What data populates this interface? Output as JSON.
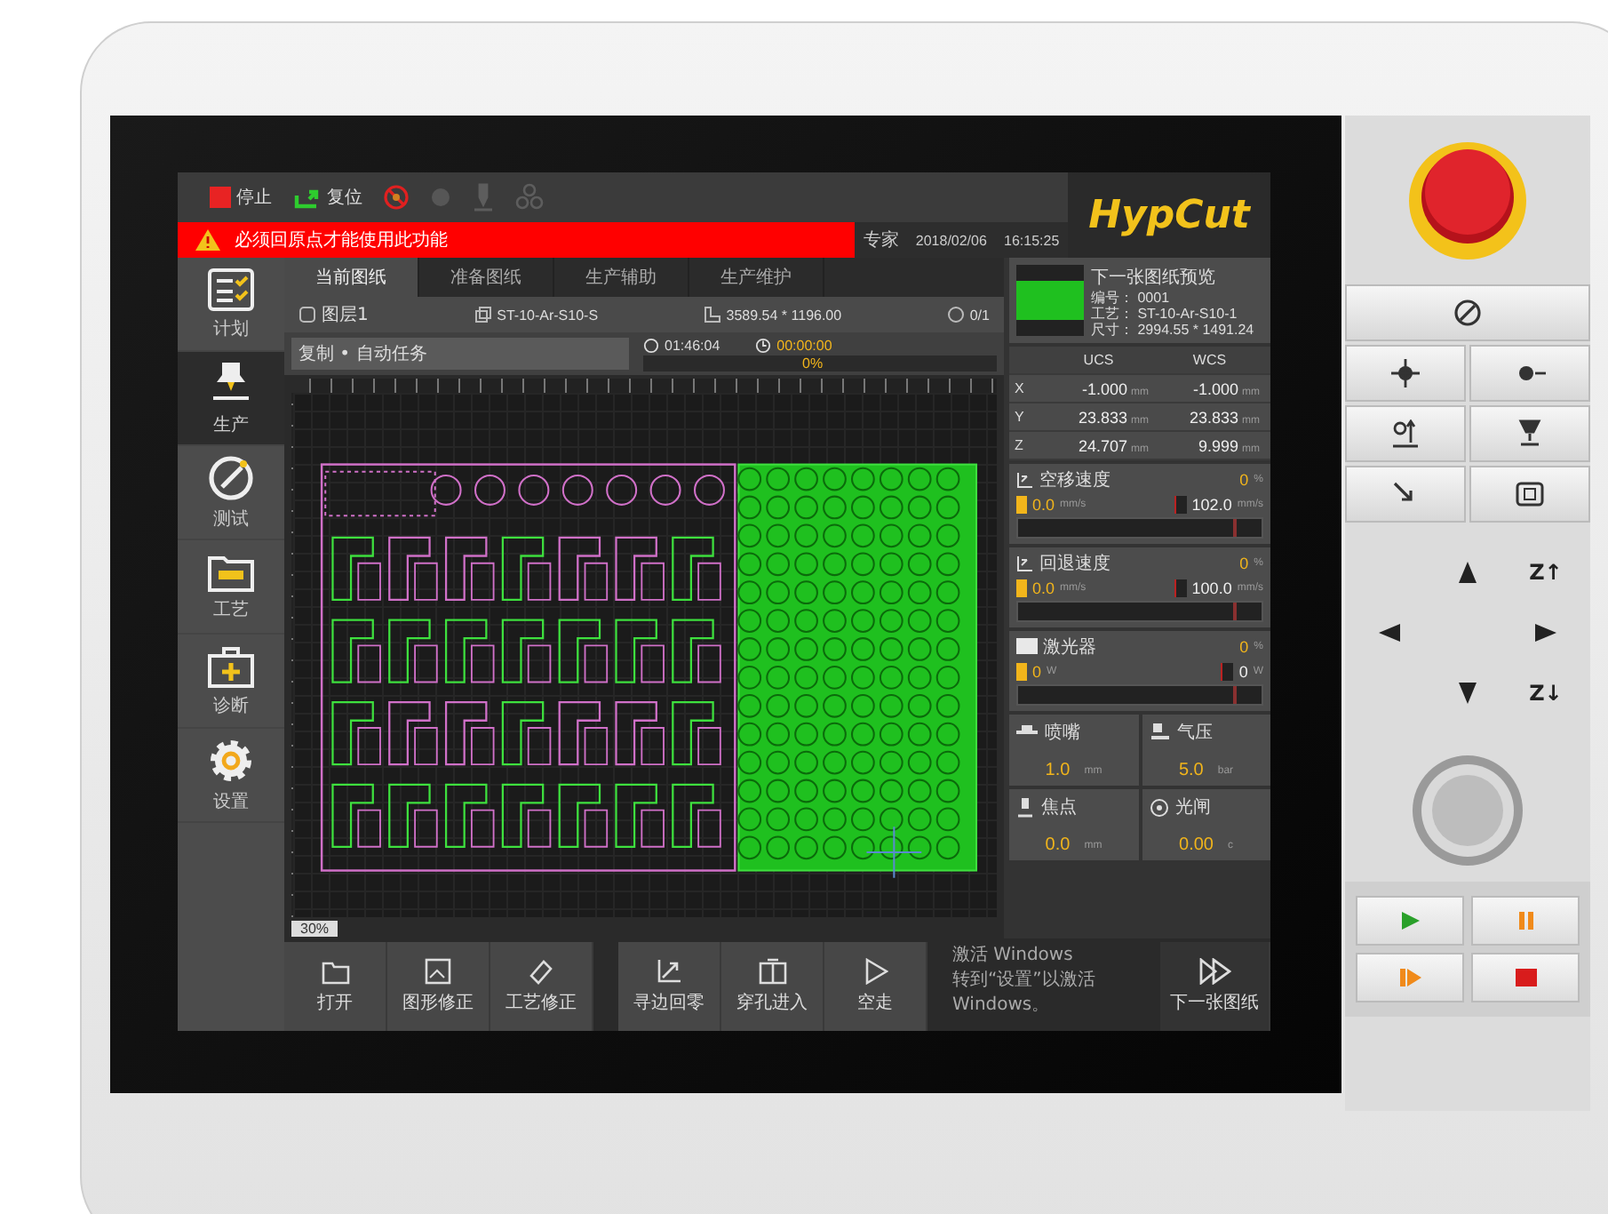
{
  "toolbar": [
    {
      "kind": "stop",
      "label": "停止",
      "enabled": true
    },
    {
      "kind": "return",
      "label": "复位",
      "enabled": true
    },
    {
      "kind": "laser",
      "enabled": true
    },
    {
      "kind": "dot",
      "enabled": false
    },
    {
      "kind": "pin",
      "enabled": false
    },
    {
      "kind": "fan",
      "enabled": false
    }
  ],
  "alert": {
    "text": "必须回原点才能使用此功能"
  },
  "status": {
    "user": "专家",
    "date": "2018/02/06",
    "time": "16:15:25"
  },
  "logo": "HypCut",
  "sidebar": [
    {
      "kind": "plan",
      "label": "计划",
      "selected": false
    },
    {
      "kind": "produce",
      "label": "生产",
      "selected": true
    },
    {
      "kind": "test",
      "label": "测试",
      "selected": false
    },
    {
      "kind": "process",
      "label": "工艺",
      "selected": false
    },
    {
      "kind": "diagnose",
      "label": "诊断",
      "selected": false
    },
    {
      "kind": "settings",
      "label": "设置",
      "selected": false
    }
  ],
  "tabs": [
    {
      "label": "当前图纸",
      "selected": true
    },
    {
      "label": "准备图纸",
      "selected": false
    },
    {
      "label": "生产辅助",
      "selected": false
    },
    {
      "label": "生产维护",
      "selected": false
    }
  ],
  "file_info": {
    "layer": "图层1",
    "process": "ST-10-Ar-S10-S",
    "size": "3589.54 * 1196.00",
    "count": "0/1"
  },
  "task": {
    "mode": "复制 • 自动任务",
    "elapsed": "01:46:04",
    "remaining": "00:00:00",
    "progress": "0%",
    "level": 0
  },
  "zoom": "30%",
  "preview": {
    "title": "下一张图纸预览",
    "lines": [
      {
        "key": "编号：",
        "value": "0001"
      },
      {
        "key": "工艺：",
        "value": "ST-10-Ar-S10-1"
      },
      {
        "key": "尺寸：",
        "value": "2994.55 * 1491.24"
      }
    ]
  },
  "coords": {
    "columns": [
      "UCS",
      "WCS"
    ],
    "rows": [
      {
        "axis": "X",
        "ucs": "-1.000",
        "ucs_unit": "mm",
        "wcs": "-1.000",
        "wcs_unit": "mm"
      },
      {
        "axis": "Y",
        "ucs": "23.833",
        "ucs_unit": "mm",
        "wcs": "23.833",
        "wcs_unit": "mm"
      },
      {
        "axis": "Z",
        "ucs": "24.707",
        "ucs_unit": "mm",
        "wcs": "9.999",
        "wcs_unit": "mm"
      }
    ]
  },
  "gauges": [
    {
      "kind": "speed",
      "label": "空移速度",
      "percent": "0",
      "percent_unit": "%",
      "value": "0.0",
      "value_unit": "mm/s",
      "max": "102.0",
      "max_unit": "mm/s",
      "level": 0.88
    },
    {
      "kind": "speed",
      "label": "回退速度",
      "percent": "0",
      "percent_unit": "%",
      "value": "0.0",
      "value_unit": "mm/s",
      "max": "100.0",
      "max_unit": "mm/s",
      "level": 0.88
    },
    {
      "kind": "laser",
      "label": "激光器",
      "percent": "0",
      "percent_unit": "%",
      "value": "0",
      "value_unit": "W",
      "max": "0",
      "max_unit": "W",
      "level": 0.88
    }
  ],
  "tiles": [
    {
      "kind": "nozzle",
      "label": "喷嘴",
      "value": "1.0",
      "unit": "mm"
    },
    {
      "kind": "gas",
      "label": "气压",
      "value": "5.0",
      "unit": "bar"
    },
    {
      "kind": "focus",
      "label": "焦点",
      "value": "0.0",
      "unit": "mm"
    },
    {
      "kind": "shutter",
      "label": "光闸",
      "value": "0.00",
      "unit": "c"
    }
  ],
  "buttons_left": [
    {
      "kind": "open",
      "label": "打开"
    },
    {
      "kind": "shape",
      "label": "图形修正"
    },
    {
      "kind": "process",
      "label": "工艺修正"
    }
  ],
  "buttons_mid": [
    {
      "kind": "origin",
      "label": "寻边回零"
    },
    {
      "kind": "pierce",
      "label": "穿孔进入"
    },
    {
      "kind": "run",
      "label": "空走"
    }
  ],
  "next_button": {
    "label": "下一张图纸"
  },
  "os_notice": {
    "title": "激活 Windows",
    "text": "转到“设置”以激活 Windows。"
  },
  "device": {
    "z_up": "Z↑",
    "z_down": "Z↓"
  }
}
